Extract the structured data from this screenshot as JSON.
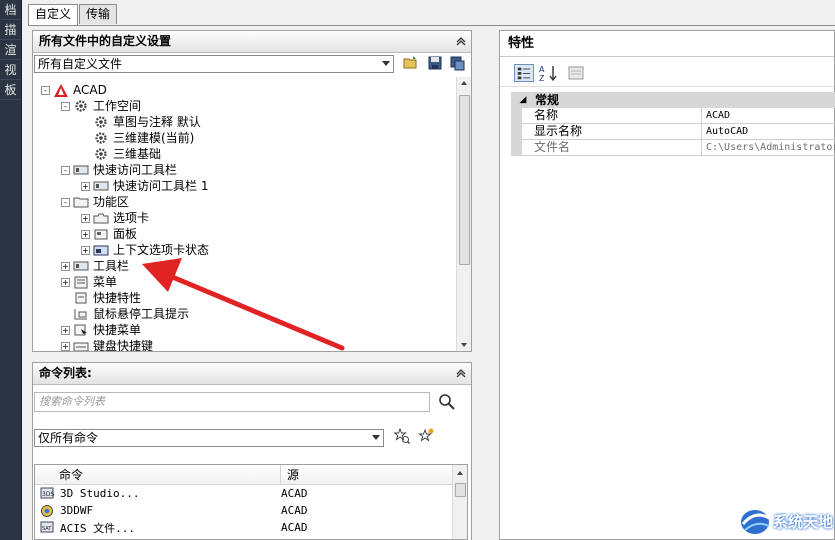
{
  "left_strip": [
    "档",
    "描",
    "渲",
    "视",
    "板"
  ],
  "tabs": [
    {
      "label": "自定义"
    },
    {
      "label": "传输"
    }
  ],
  "customize_panel": {
    "title": "所有文件中的自定义设置",
    "file_dropdown": "所有自定义文件",
    "tree": [
      {
        "label": "ACAD",
        "level": 0,
        "icon": "acad-logo-icon",
        "expander": "-"
      },
      {
        "label": "工作空间",
        "level": 1,
        "icon": "gear-icon",
        "expander": "-"
      },
      {
        "label": "草图与注释 默认",
        "level": 2,
        "icon": "gear-icon",
        "expander": ""
      },
      {
        "label": "三维建模(当前)",
        "level": 2,
        "icon": "gear-icon",
        "expander": ""
      },
      {
        "label": "三维基础",
        "level": 2,
        "icon": "gear-icon",
        "expander": ""
      },
      {
        "label": "快速访问工具栏",
        "level": 1,
        "icon": "toolbar-icon",
        "expander": "-"
      },
      {
        "label": "快速访问工具栏 1",
        "level": 2,
        "icon": "toolbar-icon",
        "expander": "+"
      },
      {
        "label": "功能区",
        "level": 1,
        "icon": "folder-icon",
        "expander": "-"
      },
      {
        "label": "选项卡",
        "level": 2,
        "icon": "tab-icon",
        "expander": "+"
      },
      {
        "label": "面板",
        "level": 2,
        "icon": "panel-icon",
        "expander": "+"
      },
      {
        "label": "上下文选项卡状态",
        "level": 2,
        "icon": "context-tab-icon",
        "expander": "+"
      },
      {
        "label": "工具栏",
        "level": 1,
        "icon": "toolbar-icon",
        "expander": "+"
      },
      {
        "label": "菜单",
        "level": 1,
        "icon": "menu-icon",
        "expander": "+"
      },
      {
        "label": "快捷特性",
        "level": 1,
        "icon": "quick-props-icon",
        "expander": ""
      },
      {
        "label": "鼠标悬停工具提示",
        "level": 1,
        "icon": "tooltip-icon",
        "expander": ""
      },
      {
        "label": "快捷菜单",
        "level": 1,
        "icon": "shortcut-menu-icon",
        "expander": "+"
      },
      {
        "label": "键盘快捷键",
        "level": 1,
        "icon": "keyboard-icon",
        "expander": "+"
      }
    ]
  },
  "command_panel": {
    "title": "命令列表:",
    "search_placeholder": "搜索命令列表",
    "filter_dropdown": "仅所有命令",
    "columns": [
      "命令",
      "源"
    ],
    "rows": [
      {
        "name": "3D Studio...",
        "source": "ACAD",
        "icon": "3ds-icon"
      },
      {
        "name": "3DDWF",
        "source": "ACAD",
        "icon": "dwf-icon"
      },
      {
        "name": "ACIS 文件...",
        "source": "ACAD",
        "icon": "acis-icon"
      }
    ]
  },
  "properties_panel": {
    "title": "特性",
    "category": "常规",
    "rows": [
      {
        "key": "名称",
        "value": "ACAD",
        "readonly": false
      },
      {
        "key": "显示名称",
        "value": "AutoCAD",
        "readonly": false
      },
      {
        "key": "文件名",
        "value": "C:\\Users\\Administrator",
        "readonly": true
      }
    ]
  },
  "watermark": "系统天地",
  "colors": {
    "accent_red": "#e02424",
    "panel_header": "#e3e3e3",
    "strip_bg": "#2b3442"
  }
}
